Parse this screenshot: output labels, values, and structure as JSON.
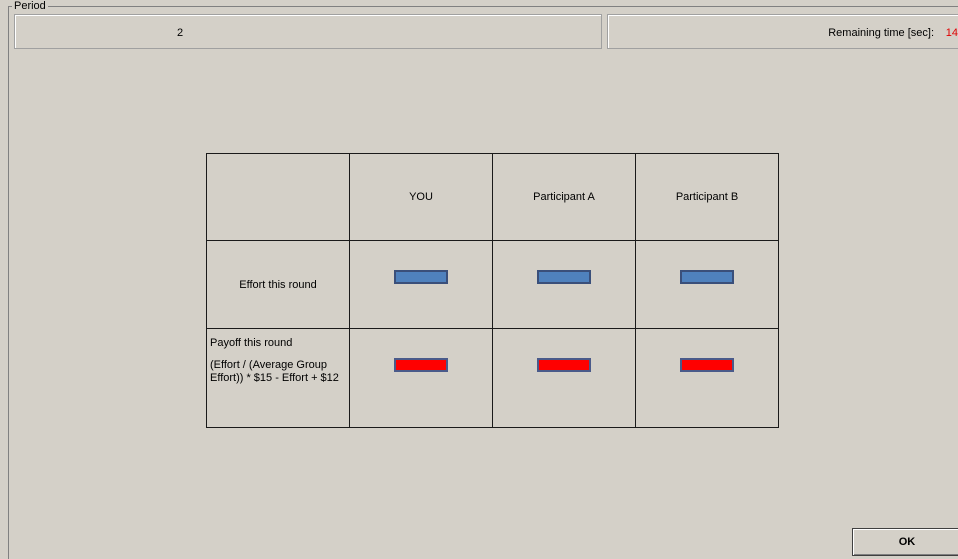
{
  "header": {
    "period_label": "Period",
    "period_value": "2",
    "remaining_label": "Remaining time [sec]:",
    "remaining_value": "14"
  },
  "table": {
    "columns": [
      "YOU",
      "Participant A",
      "Participant B"
    ],
    "rows": {
      "effort_label": "Effort this round",
      "payoff_title": "Payoff this round",
      "payoff_formula": "(Effort / (Average Group Effort)) * $15  -  Effort  +  $12"
    }
  },
  "colors": {
    "effort_bar": "#4f81bd",
    "payoff_bar": "#ff0000",
    "remaining_value": "#e00000"
  },
  "buttons": {
    "ok_label": "OK"
  }
}
